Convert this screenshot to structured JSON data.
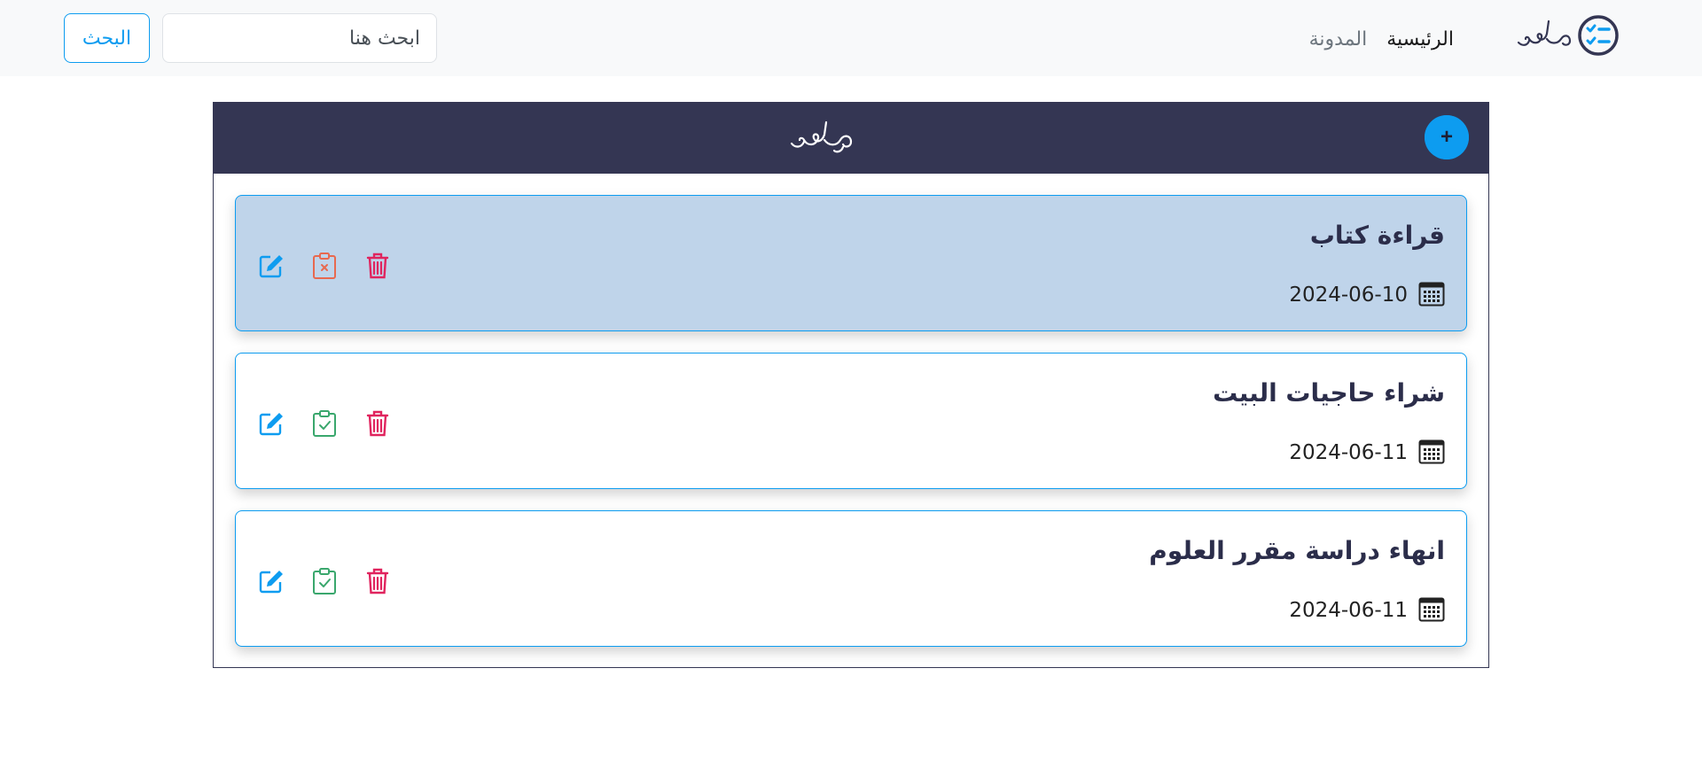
{
  "navbar": {
    "brand_icon": "checklist-icon",
    "brand_script_icon": "mahami-logo",
    "links": [
      {
        "label": "الرئيسية",
        "active": true
      },
      {
        "label": "المدونة",
        "active": false
      }
    ],
    "search": {
      "placeholder": "ابحث هنا",
      "value": ""
    },
    "search_button_label": "البحث"
  },
  "panel": {
    "header_logo_icon": "mahami-logo",
    "add_button_label": "+"
  },
  "tasks": [
    {
      "title": "قراءة كتاب",
      "date": "2024-06-10",
      "completed": true,
      "toggle_icon": "clipboard-x-icon"
    },
    {
      "title": "شراء حاجيات البيت",
      "date": "2024-06-11",
      "completed": false,
      "toggle_icon": "clipboard-check-icon"
    },
    {
      "title": "انهاء دراسة مقرر العلوم",
      "date": "2024-06-11",
      "completed": false,
      "toggle_icon": "clipboard-check-icon"
    }
  ],
  "colors": {
    "accent": "#0d9cf0",
    "dark": "#343653",
    "completed_bg": "#bfd4ea",
    "delete": "#e0245e",
    "uncomplete": "#e8694f",
    "complete": "#3aa76d"
  }
}
